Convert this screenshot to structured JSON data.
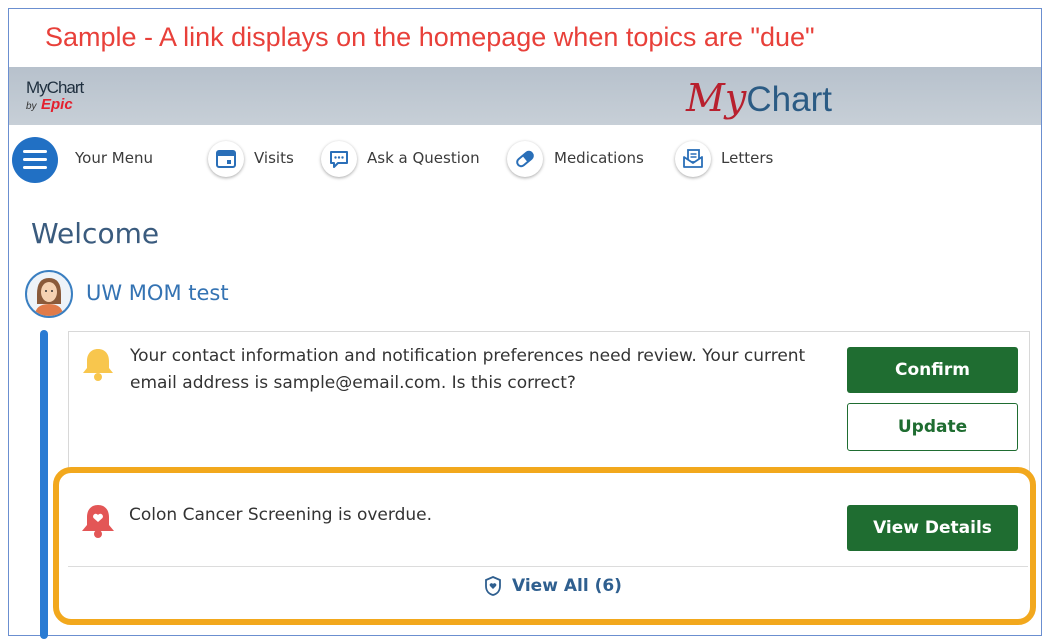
{
  "caption": "Sample -  A link displays on the homepage when topics are \"due\"",
  "branding": {
    "logo_small_line1": "MyChart",
    "logo_small_by": "by",
    "logo_small_epic": "Epic",
    "logo_big_my": "My",
    "logo_big_chart": "Chart"
  },
  "nav": {
    "menu_label": "Your Menu",
    "items": [
      {
        "label": "Visits",
        "icon": "calendar-icon"
      },
      {
        "label": "Ask a Question",
        "icon": "chat-bubble-icon"
      },
      {
        "label": "Medications",
        "icon": "pill-icon"
      },
      {
        "label": "Letters",
        "icon": "letter-icon"
      }
    ]
  },
  "welcome": "Welcome",
  "user": {
    "name": "UW MOM test"
  },
  "notifications": [
    {
      "icon": "bell-icon",
      "text_line1": "Your contact information and notification preferences need review. Your current",
      "text_line2": "email address is sample@email.com. Is this correct?",
      "primary_button": "Confirm",
      "secondary_button": "Update"
    },
    {
      "icon": "health-alert-bell-icon",
      "text": "Colon Cancer Screening is overdue.",
      "primary_button": "View Details"
    }
  ],
  "view_all": "View All (6)",
  "colors": {
    "caption_red": "#e8403a",
    "banner_gray": "#c0c9d2",
    "menu_blue": "#2170c4",
    "accent_green": "#1f6d31",
    "highlight_orange": "#f2a81d",
    "bell_yellow": "#f8c64d",
    "alert_red": "#e35656"
  }
}
